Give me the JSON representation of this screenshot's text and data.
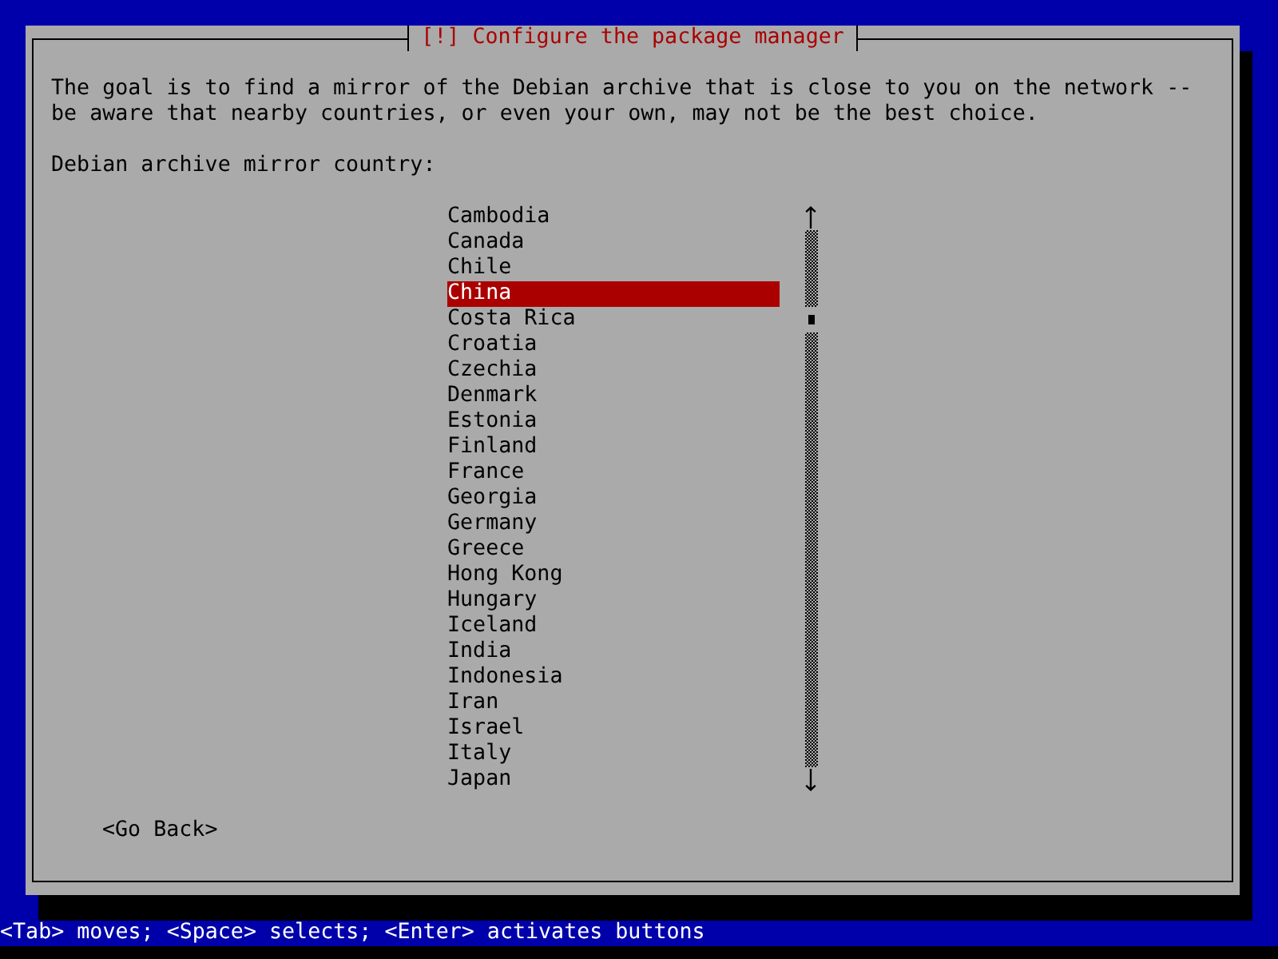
{
  "dialog": {
    "title": "[!] Configure the package manager",
    "description": "The goal is to find a mirror of the Debian archive that is close to you on the network -- be aware that nearby countries, or even your own, may not be the best choice.",
    "prompt": "Debian archive mirror country:",
    "countries": [
      {
        "label": "Cambodia",
        "selected": false
      },
      {
        "label": "Canada",
        "selected": false
      },
      {
        "label": "Chile",
        "selected": false
      },
      {
        "label": "China",
        "selected": true
      },
      {
        "label": "Costa Rica",
        "selected": false
      },
      {
        "label": "Croatia",
        "selected": false
      },
      {
        "label": "Czechia",
        "selected": false
      },
      {
        "label": "Denmark",
        "selected": false
      },
      {
        "label": "Estonia",
        "selected": false
      },
      {
        "label": "Finland",
        "selected": false
      },
      {
        "label": "France",
        "selected": false
      },
      {
        "label": "Georgia",
        "selected": false
      },
      {
        "label": "Germany",
        "selected": false
      },
      {
        "label": "Greece",
        "selected": false
      },
      {
        "label": "Hong Kong",
        "selected": false
      },
      {
        "label": "Hungary",
        "selected": false
      },
      {
        "label": "Iceland",
        "selected": false
      },
      {
        "label": "India",
        "selected": false
      },
      {
        "label": "Indonesia",
        "selected": false
      },
      {
        "label": "Iran",
        "selected": false
      },
      {
        "label": "Israel",
        "selected": false
      },
      {
        "label": "Italy",
        "selected": false
      },
      {
        "label": "Japan",
        "selected": false
      }
    ],
    "buttons": [
      "<Go Back>"
    ]
  },
  "status_bar": "<Tab> moves; <Space> selects; <Enter> activates buttons"
}
